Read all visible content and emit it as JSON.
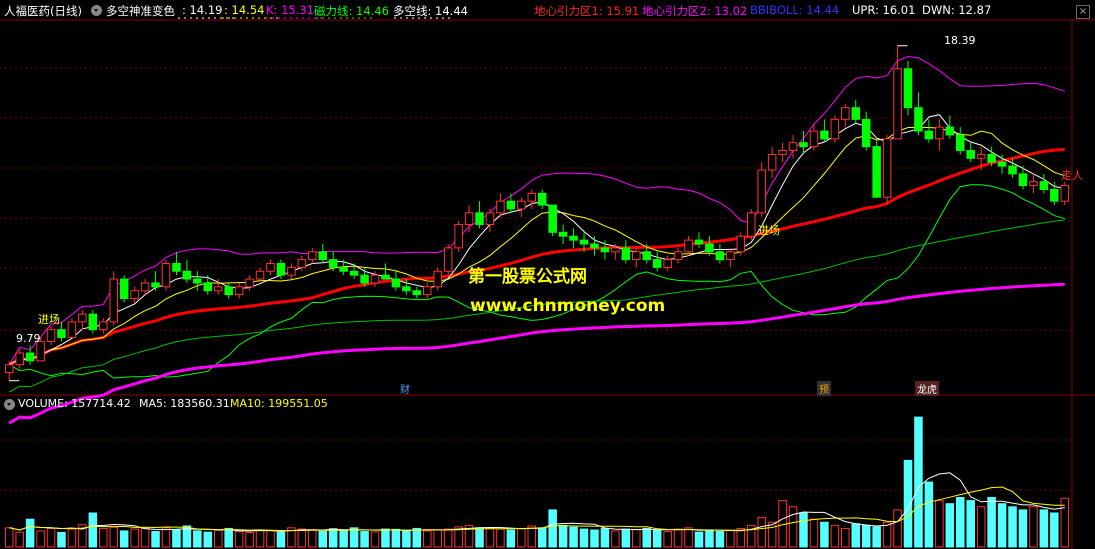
{
  "header": {
    "stock_name": "人福医药(日线)",
    "indicator_name": "多空神准变色",
    "v1": ": 14.19",
    "v2": ": 14.54",
    "k_label": "K: 15.31",
    "cili_label": "磁力线: 14.46",
    "duokong_label": "多空线: 14.44",
    "dixin1_label": "地心引力区1: 15.91",
    "dixin2_label": "地心引力区2: 13.02",
    "boll_label": "BBIBOLL: 14.44",
    "upr_label": "UPR: 16.01",
    "dwn_label": "DWN: 12.87"
  },
  "volume_header": {
    "vol_label": "VOLUME: 157714.42",
    "ma5_label": "MA5: 183560.31",
    "ma10_label": "MA10: 199551.05"
  },
  "annotations": {
    "high_price": "18.39",
    "low_price": "9.79",
    "entry1": "进场",
    "entry2": "进场",
    "exit": "走人",
    "marker_cai": "财",
    "marker_yu": "预",
    "marker_long": "龙虎"
  },
  "watermark": {
    "line1": "第一股票公式网",
    "line2": "www.chnmoney.com"
  },
  "colors": {
    "up": "#ff3232",
    "down": "#00ff00",
    "boll_upper": "#ff00ff",
    "boll_lower": "#00ff00",
    "cili": "#ff00ff",
    "red_line": "#ff0000",
    "yellow": "#ffff00",
    "white": "#ffffff",
    "vol_up": "#ff3232",
    "vol_down": "#54ffff"
  },
  "chart_data": {
    "type": "candlestick",
    "ylim": [
      9.5,
      19.0
    ],
    "candles": [
      [
        10.0,
        10.3,
        9.79,
        10.2
      ],
      [
        10.2,
        10.6,
        10.1,
        10.5
      ],
      [
        10.5,
        10.7,
        10.2,
        10.3
      ],
      [
        10.3,
        10.9,
        10.3,
        10.8
      ],
      [
        10.8,
        11.2,
        10.7,
        11.1
      ],
      [
        11.1,
        11.3,
        10.8,
        10.9
      ],
      [
        10.9,
        11.4,
        10.9,
        11.3
      ],
      [
        11.3,
        11.6,
        11.1,
        11.5
      ],
      [
        11.5,
        11.6,
        11.0,
        11.1
      ],
      [
        11.1,
        11.4,
        11.0,
        11.3
      ],
      [
        11.3,
        12.6,
        11.2,
        12.4
      ],
      [
        12.4,
        12.5,
        11.8,
        11.9
      ],
      [
        11.9,
        12.2,
        11.8,
        12.1
      ],
      [
        12.1,
        12.4,
        12.0,
        12.3
      ],
      [
        12.3,
        12.6,
        12.1,
        12.2
      ],
      [
        12.2,
        12.9,
        12.1,
        12.8
      ],
      [
        12.8,
        13.1,
        12.5,
        12.6
      ],
      [
        12.6,
        12.9,
        12.3,
        12.4
      ],
      [
        12.4,
        12.6,
        12.1,
        12.3
      ],
      [
        12.3,
        12.5,
        12.0,
        12.1
      ],
      [
        12.1,
        12.4,
        12.0,
        12.2
      ],
      [
        12.2,
        12.3,
        11.9,
        12.0
      ],
      [
        12.0,
        12.3,
        11.9,
        12.2
      ],
      [
        12.2,
        12.5,
        12.1,
        12.4
      ],
      [
        12.4,
        12.7,
        12.3,
        12.6
      ],
      [
        12.6,
        12.9,
        12.5,
        12.8
      ],
      [
        12.8,
        12.9,
        12.4,
        12.5
      ],
      [
        12.5,
        12.8,
        12.4,
        12.7
      ],
      [
        12.7,
        13.0,
        12.6,
        12.9
      ],
      [
        12.9,
        13.2,
        12.8,
        13.1
      ],
      [
        13.1,
        13.3,
        12.8,
        12.9
      ],
      [
        12.9,
        13.1,
        12.6,
        12.7
      ],
      [
        12.7,
        12.9,
        12.5,
        12.6
      ],
      [
        12.6,
        12.8,
        12.4,
        12.5
      ],
      [
        12.5,
        12.7,
        12.2,
        12.3
      ],
      [
        12.3,
        12.6,
        12.2,
        12.5
      ],
      [
        12.5,
        12.8,
        12.4,
        12.4
      ],
      [
        12.4,
        12.6,
        12.1,
        12.2
      ],
      [
        12.2,
        12.4,
        12.0,
        12.1
      ],
      [
        12.1,
        12.2,
        11.9,
        12.0
      ],
      [
        12.0,
        12.3,
        11.9,
        12.2
      ],
      [
        12.2,
        12.7,
        12.1,
        12.6
      ],
      [
        12.6,
        13.3,
        12.5,
        13.2
      ],
      [
        13.2,
        13.9,
        13.1,
        13.8
      ],
      [
        13.8,
        14.3,
        13.6,
        14.1
      ],
      [
        14.1,
        14.4,
        13.7,
        13.8
      ],
      [
        13.8,
        14.2,
        13.6,
        14.1
      ],
      [
        14.1,
        14.6,
        14.0,
        14.4
      ],
      [
        14.4,
        14.6,
        14.1,
        14.2
      ],
      [
        14.2,
        14.5,
        14.0,
        14.4
      ],
      [
        14.4,
        14.7,
        14.2,
        14.6
      ],
      [
        14.6,
        14.7,
        14.2,
        14.3
      ],
      [
        14.3,
        14.2,
        13.5,
        13.6
      ],
      [
        13.6,
        13.8,
        13.3,
        13.5
      ],
      [
        13.5,
        13.7,
        13.2,
        13.4
      ],
      [
        13.4,
        13.6,
        13.1,
        13.3
      ],
      [
        13.3,
        13.5,
        13.0,
        13.2
      ],
      [
        13.2,
        13.4,
        12.9,
        13.1
      ],
      [
        13.1,
        13.3,
        12.9,
        13.2
      ],
      [
        13.2,
        13.4,
        12.8,
        12.9
      ],
      [
        12.9,
        13.2,
        12.7,
        13.1
      ],
      [
        13.1,
        13.3,
        12.8,
        12.9
      ],
      [
        12.9,
        13.1,
        12.6,
        12.7
      ],
      [
        12.7,
        13.0,
        12.6,
        12.9
      ],
      [
        12.9,
        13.2,
        12.8,
        13.1
      ],
      [
        13.1,
        13.5,
        13.0,
        13.4
      ],
      [
        13.4,
        13.6,
        13.2,
        13.3
      ],
      [
        13.3,
        13.5,
        13.0,
        13.1
      ],
      [
        13.1,
        13.3,
        12.8,
        12.9
      ],
      [
        12.9,
        13.2,
        12.7,
        13.1
      ],
      [
        13.1,
        13.6,
        13.0,
        13.5
      ],
      [
        13.5,
        14.2,
        13.4,
        14.1
      ],
      [
        14.1,
        15.4,
        14.0,
        15.2
      ],
      [
        15.2,
        15.8,
        15.0,
        15.6
      ],
      [
        15.6,
        15.9,
        15.4,
        15.7
      ],
      [
        15.7,
        16.1,
        15.5,
        15.9
      ],
      [
        15.9,
        16.2,
        15.6,
        15.8
      ],
      [
        15.8,
        16.4,
        15.7,
        16.2
      ],
      [
        16.2,
        16.5,
        15.9,
        16.0
      ],
      [
        16.0,
        16.6,
        15.9,
        16.5
      ],
      [
        16.5,
        16.9,
        16.3,
        16.8
      ],
      [
        16.8,
        17.0,
        16.4,
        16.5
      ],
      [
        16.5,
        16.7,
        15.7,
        15.8
      ],
      [
        15.8,
        16.0,
        15.3,
        14.5
      ],
      [
        14.5,
        16.1,
        14.3,
        16.0
      ],
      [
        16.0,
        18.39,
        16.0,
        17.8
      ],
      [
        17.8,
        18.0,
        16.6,
        16.8
      ],
      [
        16.8,
        17.2,
        16.1,
        16.2
      ],
      [
        16.2,
        16.5,
        15.9,
        16.0
      ],
      [
        16.0,
        16.5,
        15.7,
        16.3
      ],
      [
        16.3,
        16.6,
        16.0,
        16.1
      ],
      [
        16.1,
        16.3,
        15.6,
        15.7
      ],
      [
        15.7,
        15.9,
        15.4,
        15.5
      ],
      [
        15.5,
        15.8,
        15.2,
        15.6
      ],
      [
        15.6,
        15.8,
        15.3,
        15.4
      ],
      [
        15.4,
        15.6,
        15.1,
        15.3
      ],
      [
        15.3,
        15.5,
        15.0,
        15.1
      ],
      [
        15.1,
        15.3,
        14.7,
        14.8
      ],
      [
        14.8,
        15.1,
        14.6,
        14.9
      ],
      [
        14.9,
        15.1,
        14.6,
        14.7
      ],
      [
        14.7,
        14.9,
        14.3,
        14.4
      ],
      [
        14.4,
        14.9,
        14.3,
        14.8
      ]
    ],
    "volume": [
      62000,
      48000,
      90000,
      52000,
      60000,
      47000,
      58000,
      72000,
      110000,
      60000,
      64000,
      52000,
      58000,
      60000,
      50000,
      62000,
      56000,
      68000,
      52000,
      48000,
      54000,
      60000,
      50000,
      47000,
      55000,
      53000,
      48000,
      62000,
      58000,
      56000,
      51000,
      59000,
      54000,
      62000,
      50000,
      49000,
      58000,
      57000,
      51000,
      60000,
      52000,
      56000,
      58000,
      65000,
      70000,
      62000,
      60000,
      58000,
      55000,
      60000,
      68000,
      62000,
      120000,
      70000,
      64000,
      58000,
      55000,
      60000,
      52000,
      58000,
      56000,
      60000,
      54000,
      50000,
      58000,
      62000,
      48000,
      52000,
      50000,
      54000,
      60000,
      70000,
      95000,
      80000,
      150000,
      130000,
      110000,
      90000,
      80000,
      70000,
      60000,
      75000,
      70000,
      65000,
      80000,
      120000,
      280000,
      420000,
      210000,
      150000,
      140000,
      160000,
      150000,
      130000,
      160000,
      140000,
      130000,
      120000,
      130000,
      120000,
      110000,
      157714
    ],
    "vol_ylim": [
      0,
      430000
    ]
  }
}
